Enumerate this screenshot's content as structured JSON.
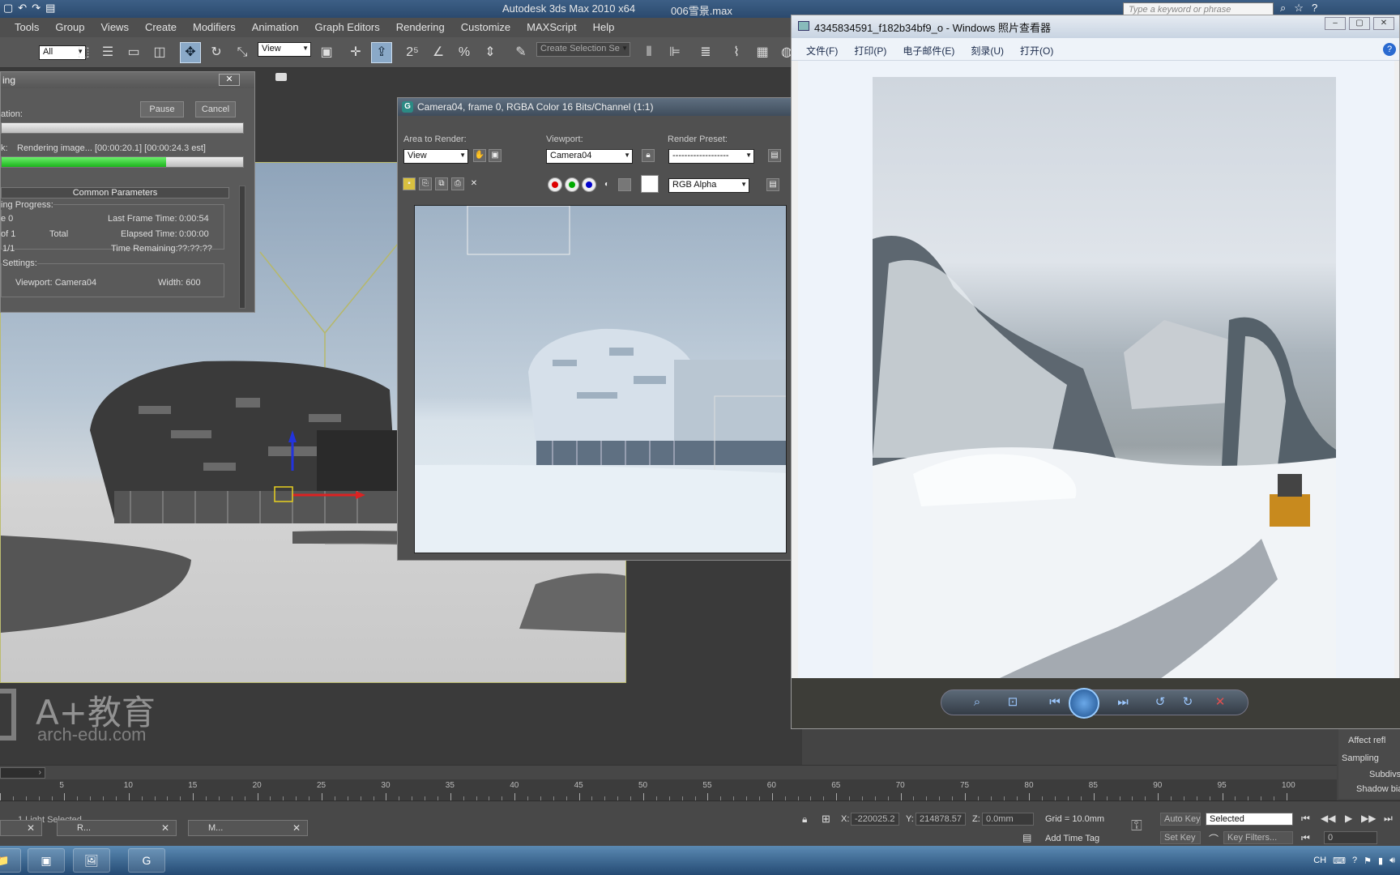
{
  "app": {
    "title": "Autodesk 3ds Max  2010 x64",
    "file": "006雪景.max",
    "search_placeholder": "Type a keyword or phrase"
  },
  "menu": [
    "Tools",
    "Group",
    "Views",
    "Create",
    "Modifiers",
    "Animation",
    "Graph Editors",
    "Rendering",
    "Customize",
    "MAXScript",
    "Help"
  ],
  "toolbar": {
    "selection_filter": "All",
    "ref_coord": "View",
    "named_selection": "Create Selection Se"
  },
  "progress_dialog": {
    "title": "ing",
    "close": "✕",
    "line1_label": "ation:",
    "pause": "Pause",
    "cancel": "Cancel",
    "task_label": "k:",
    "task_text": "Rendering image...  [00:00:20.1]  [00:00:24.3 est]",
    "task_progress": 0.68,
    "common_parameters": "Common Parameters",
    "rendering_progress": "ing Progress:",
    "frame": "e  0",
    "of": "of 1",
    "total": "Total",
    "pass": "1/1",
    "last_frame_time_label": "Last Frame Time:",
    "last_frame_time": "0:00:54",
    "elapsed_label": "Elapsed Time:",
    "elapsed": "0:00:00",
    "remaining_label": "Time Remaining:",
    "remaining": "??:??:??",
    "settings": "Settings:",
    "viewport_label": "Viewport: Camera04",
    "width_label": "Width: 600"
  },
  "render_frame": {
    "title": "Camera04, frame 0, RGBA Color 16 Bits/Channel (1:1)",
    "area_label": "Area to Render:",
    "area_value": "View",
    "viewport_label": "Viewport:",
    "viewport_value": "Camera04",
    "preset_label": "Render Preset:",
    "preset_value": "-------------------",
    "channel_value": "RGB Alpha"
  },
  "photo_viewer": {
    "title": "4345834591_f182b34bf9_o - Windows 照片查看器",
    "menu": [
      "文件(F)",
      "打印(P)",
      "电子邮件(E)",
      "刻录(U)",
      "打开(O)"
    ],
    "help": "?"
  },
  "right_panel": {
    "affect": "Affect refl",
    "sampling": "Sampling",
    "subdivs": "Subdivs",
    "shadow_bias": "Shadow bias"
  },
  "timeline": {
    "position": "0 / 100",
    "ticks": [
      "5",
      "10",
      "15",
      "20",
      "25",
      "30",
      "35",
      "40",
      "45",
      "50",
      "55",
      "60",
      "65",
      "70",
      "75",
      "80",
      "85",
      "90",
      "95",
      "100"
    ]
  },
  "status": {
    "selection": "1 Light Selected",
    "x_label": "X:",
    "x": "-220025.2",
    "y_label": "Y:",
    "y": "214878.57",
    "z_label": "Z:",
    "z": "0.0mm",
    "grid": "Grid = 10.0mm",
    "add_time_tag": "Add Time Tag",
    "auto_key": "Auto Key",
    "set_key": "Set Key",
    "key_mode": "Selected",
    "key_filters": "Key Filters...",
    "frame": "0"
  },
  "taskbar": {
    "item1": "R...",
    "item2": "M...",
    "lang": "CH"
  },
  "watermark": {
    "brand": "A+教育",
    "url": "arch-edu.com"
  },
  "colors": {
    "progress_green": "#1cb41c",
    "viewport_border": "#bcbc70",
    "title_blue": "#2b4a6e"
  }
}
